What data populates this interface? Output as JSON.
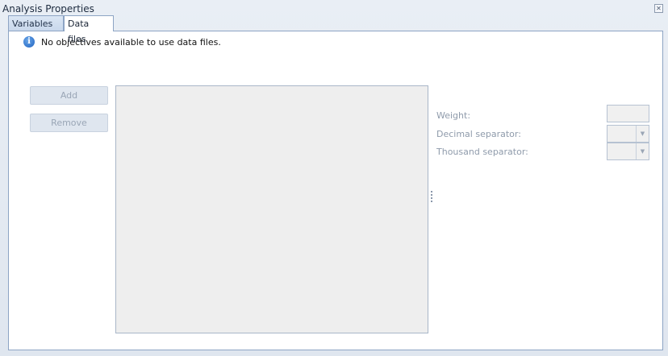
{
  "window": {
    "title": "Analysis Properties",
    "close_icon": "close-box-icon"
  },
  "tabs": [
    {
      "label": "Variables",
      "active": false
    },
    {
      "label": "Data files",
      "active": true
    }
  ],
  "info": {
    "icon": "info-icon",
    "glyph": "i",
    "message": "No objectives available to use data files."
  },
  "buttons": {
    "add_label": "Add",
    "remove_label": "Remove"
  },
  "fields": {
    "weight_label": "Weight:",
    "weight_value": "",
    "decimal_label": "Decimal separator:",
    "decimal_value": "",
    "thousand_label": "Thousand separator:",
    "thousand_value": ""
  },
  "icons": {
    "dropdown_glyph": "▼",
    "close_glyph": "✕"
  }
}
